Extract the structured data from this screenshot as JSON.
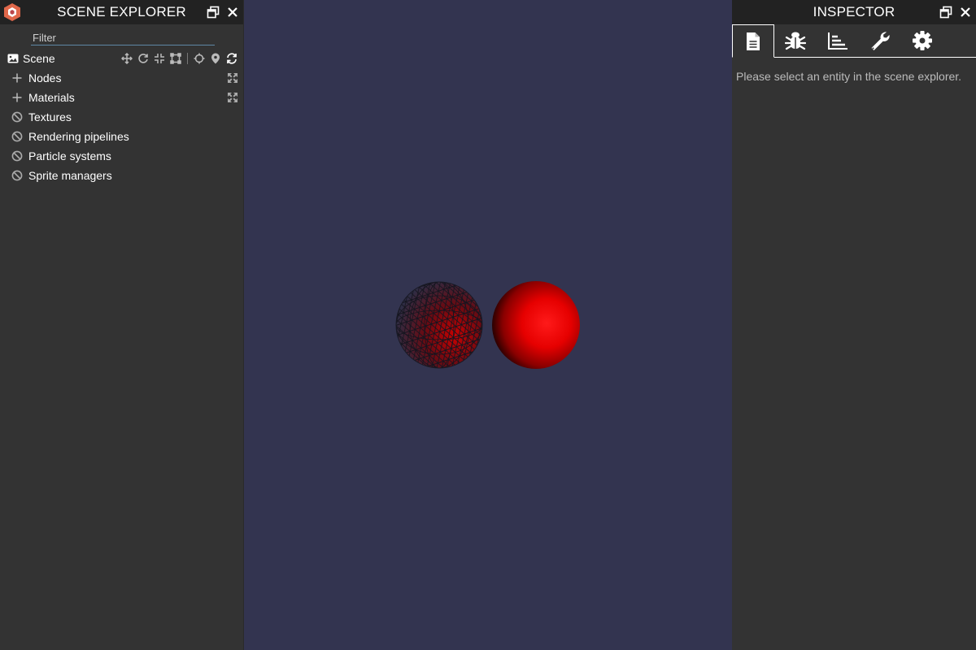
{
  "explorer": {
    "title": "SCENE EXPLORER",
    "filter_placeholder": "Filter",
    "scene_label": "Scene",
    "items": [
      {
        "label": "Nodes",
        "icon": "plus-icon",
        "expandable": true
      },
      {
        "label": "Materials",
        "icon": "plus-icon",
        "expandable": true
      },
      {
        "label": "Textures",
        "icon": "ban-icon"
      },
      {
        "label": "Rendering pipelines",
        "icon": "ban-icon"
      },
      {
        "label": "Particle systems",
        "icon": "ban-icon"
      },
      {
        "label": "Sprite managers",
        "icon": "ban-icon"
      }
    ],
    "scene_tools": [
      "translate-icon",
      "rotate-icon",
      "scale-icon",
      "bounding-box-icon",
      "crosshair-icon",
      "marker-icon",
      "refresh-icon"
    ]
  },
  "inspector": {
    "title": "INSPECTOR",
    "tabs": [
      "properties-tab",
      "debug-tab",
      "statistics-tab",
      "tools-tab",
      "settings-tab"
    ],
    "active_tab": 0,
    "empty_message": "Please select an entity in the scene explorer."
  },
  "colors": {
    "panel_bg": "#333333",
    "header_bg": "#222222",
    "viewport_bg": "#333450",
    "sphere_red": "#ff0000",
    "accent": "#5f87a5"
  }
}
